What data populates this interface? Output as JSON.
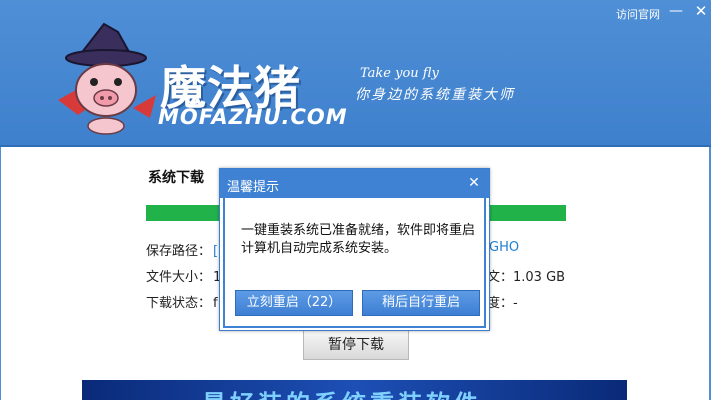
{
  "header": {
    "visit_site": "访问官网",
    "minimize_glyph": "—",
    "close_glyph": "✕",
    "brand_name": "魔法猪",
    "brand_en": "MOFAZHU.COM",
    "slogan_en": "Take you fly",
    "slogan_cn": "你身边的系统重装大师"
  },
  "download": {
    "section_title": "系统下载",
    "progress_percent": 100,
    "save_path_label": "保存路径：",
    "save_path_value_frag": "[",
    "save_path_tail": "GHO",
    "file_size_label": "文件大小：",
    "file_size_value_frag": "1",
    "file_size_tail": "文：1.03 GB",
    "status_label": "下载状态：",
    "status_value_frag": "f",
    "status_tail": "度：-",
    "pause_button": "暂停下载"
  },
  "banner": {
    "text": "最好装的系统重装软件"
  },
  "dialog": {
    "title": "温馨提示",
    "close_glyph": "✕",
    "message": "一键重装系统已准备就绪，软件即将重启计算机自动完成系统安装。",
    "restart_now": "立刻重启（22）",
    "restart_later": "稍后自行重启"
  },
  "colors": {
    "header_blue": "#4f8fd6",
    "progress_green": "#21b34a",
    "dialog_blue": "#3f82d3"
  }
}
